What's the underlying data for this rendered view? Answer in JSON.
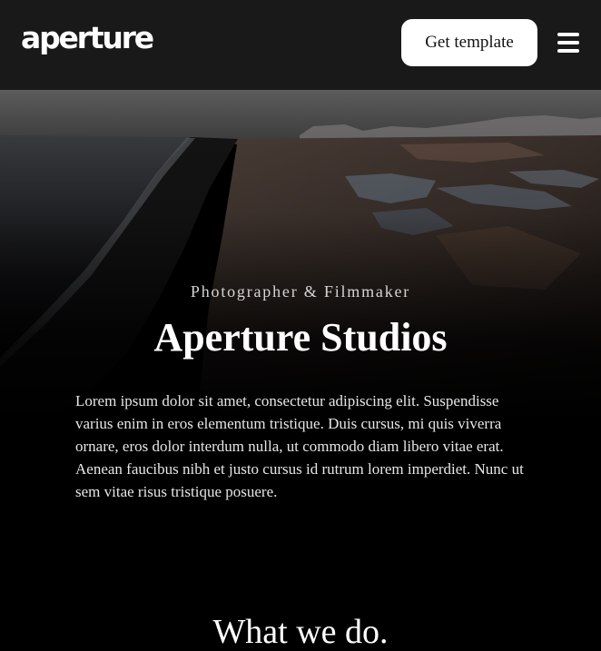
{
  "header": {
    "logo_text": "aperture",
    "cta_label": "Get template",
    "menu_icon": "hamburger-menu-icon"
  },
  "hero": {
    "background": "aerial-coastline-photo",
    "subtitle": "Photographer & Filmmaker",
    "title": "Aperture Studios",
    "body": "Lorem ipsum dolor sit amet, consectetur adipiscing elit. Suspendisse varius enim in eros elementum tristique. Duis cursus, mi quis viverra ornare, eros dolor interdum nulla, ut commodo diam libero vitae erat. Aenean faucibus nibh et justo cursus id rutrum lorem imperdiet. Nunc ut sem vitae risus tristique posuere."
  },
  "services": {
    "heading": "What we do."
  },
  "colors": {
    "header_bg": "#191919",
    "page_bg": "#000000",
    "button_bg": "#ffffff",
    "text": "#ffffff"
  }
}
